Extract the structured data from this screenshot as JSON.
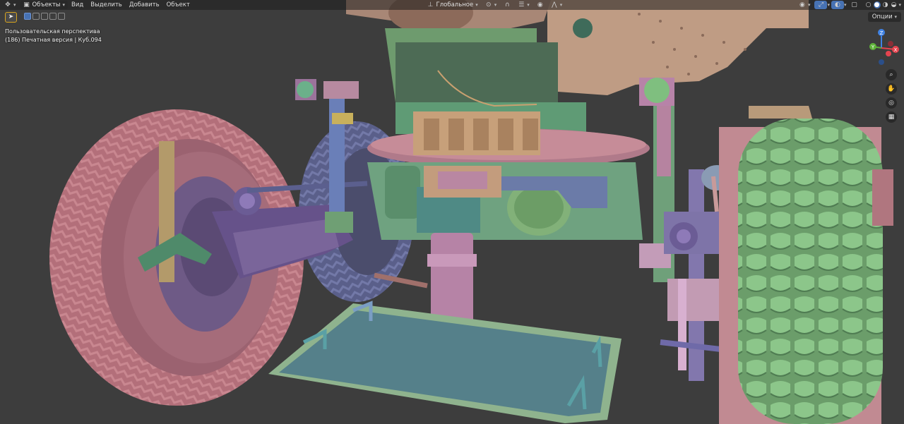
{
  "header": {
    "mode_label": "Объекты",
    "menu": [
      "Вид",
      "Выделить",
      "Добавить",
      "Объект"
    ],
    "transform_orientation": "Глобальное",
    "options_label": "Опции"
  },
  "viewport": {
    "perspective_label": "Пользовательская перспектива",
    "object_info": "(186) Печатная версия | Куб.094"
  },
  "gizmo": {
    "axes": [
      "Z",
      "Y",
      "X"
    ],
    "colors": {
      "x": "#e5444f",
      "y": "#5fb33a",
      "z": "#3f82e3"
    }
  },
  "nav_buttons": [
    "zoom-icon",
    "hand-icon",
    "camera-icon",
    "grid-icon"
  ],
  "accent": "#d9a51e"
}
